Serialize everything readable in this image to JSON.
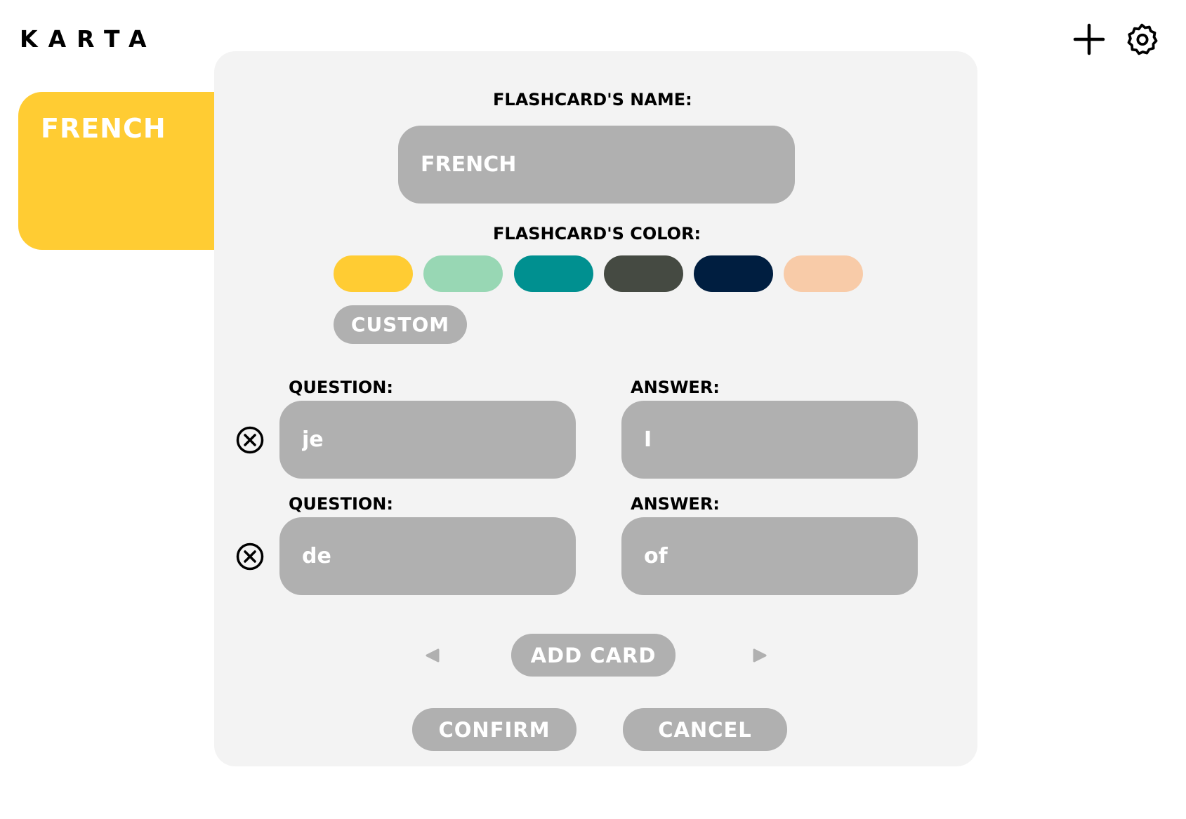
{
  "app": {
    "logo": "KARTA"
  },
  "toolbar": {
    "add_icon": "plus-icon",
    "settings_icon": "gear-icon"
  },
  "deck": {
    "title": "FRENCH",
    "color": "#FFCC33"
  },
  "editor": {
    "name_label": "FLASHCARD'S NAME:",
    "name_value": "FRENCH",
    "color_label": "FLASHCARD'S COLOR:",
    "swatches": [
      "#FFCC33",
      "#98D7B4",
      "#009090",
      "#454A42",
      "#001E40",
      "#F8CBA8"
    ],
    "custom_label": "CUSTOM",
    "cards": [
      {
        "question_label": "QUESTION:",
        "question_value": "je",
        "answer_label": "ANSWER:",
        "answer_value": "I"
      },
      {
        "question_label": "QUESTION:",
        "question_value": "de",
        "answer_label": "ANSWER:",
        "answer_value": "of"
      }
    ],
    "add_card_label": "ADD CARD",
    "confirm_label": "CONFIRM",
    "cancel_label": "CANCEL"
  }
}
